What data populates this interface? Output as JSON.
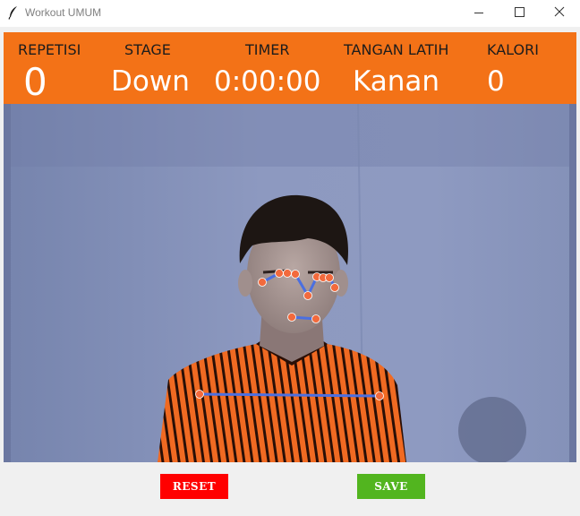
{
  "window": {
    "title": "Workout UMUM",
    "icon": "feather-icon",
    "controls": [
      "minimize-icon",
      "maximize-icon",
      "close-icon"
    ]
  },
  "hud": {
    "background": "#f37217",
    "repetisi": {
      "label": "REPETISI",
      "value": "0"
    },
    "stage": {
      "label": "STAGE",
      "value": "Down"
    },
    "timer": {
      "label": "TIMER",
      "value": "0:00:00"
    },
    "tangan": {
      "label": "TANGAN  LATIH",
      "value": "Kanan"
    },
    "kalori": {
      "label": "KALORI",
      "value": "0"
    }
  },
  "pose": {
    "landmark_color": "#f26a3d",
    "connection_color": "#4b6fe0"
  },
  "buttons": {
    "reset": {
      "label": "RESET",
      "color": "#ff0000"
    },
    "save": {
      "label": "SAVE",
      "color": "#52b51f"
    }
  }
}
